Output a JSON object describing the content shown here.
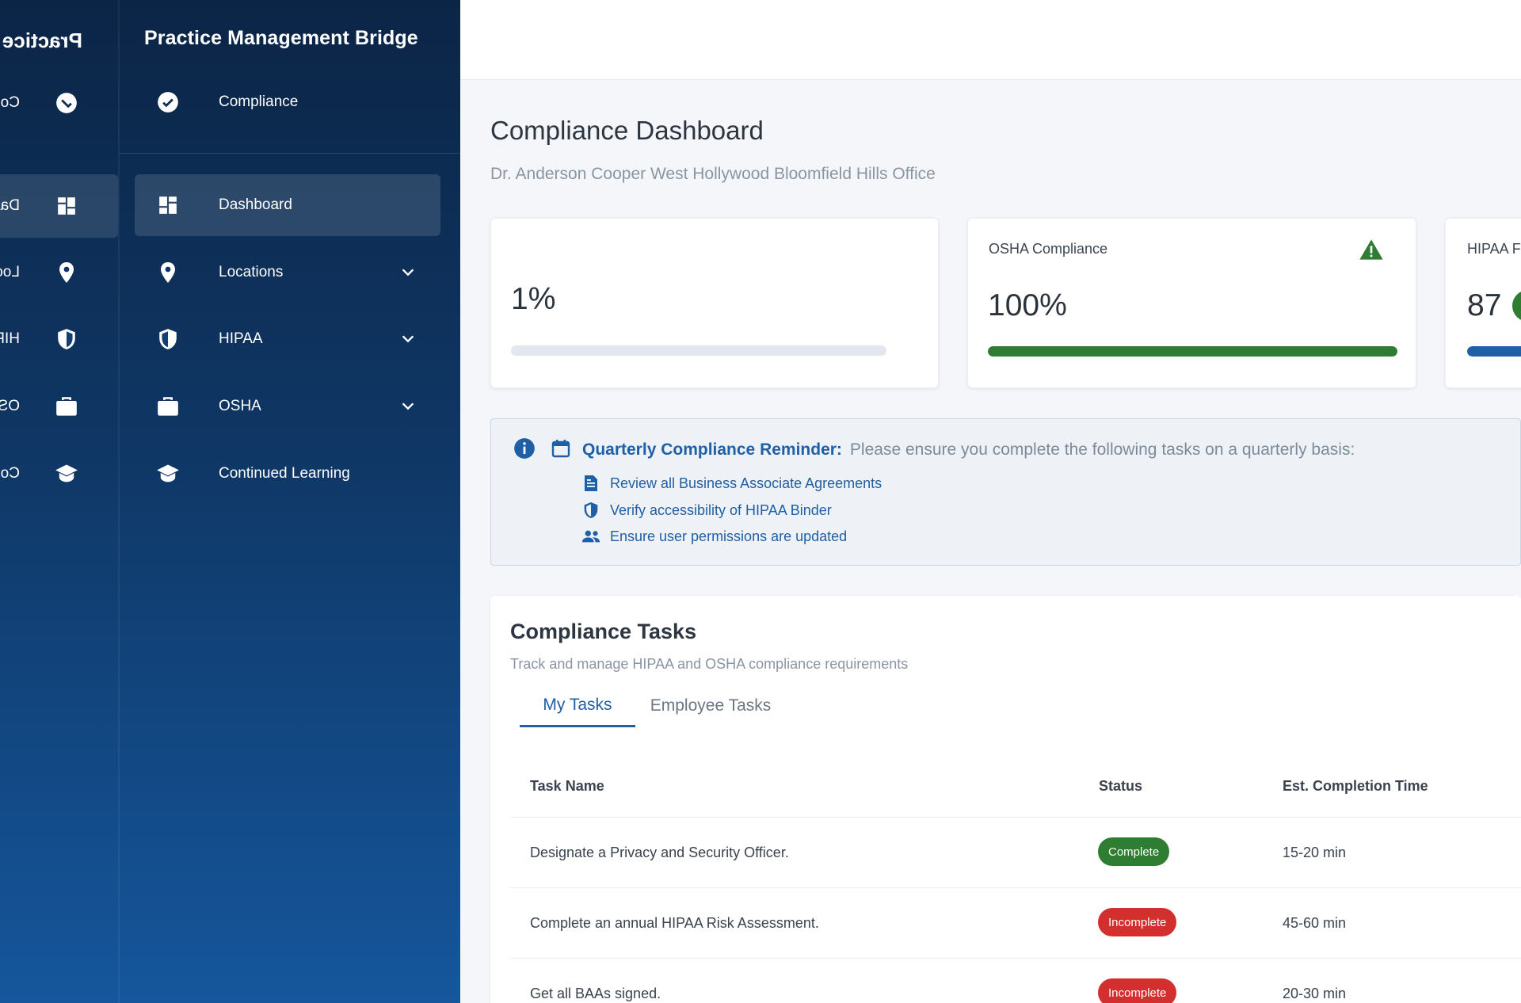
{
  "colors": {
    "accent": "#1f5fa6",
    "success": "#2e7d32",
    "danger": "#d32f2f",
    "sidebar_top": "#0b2546",
    "sidebar_bottom": "#15569c"
  },
  "sidebar": {
    "ghost_title": "Practice M",
    "ghost_labels": [
      "Com",
      "Dash",
      "Loca",
      "HIPA",
      "OSH",
      "Cont"
    ],
    "brand": "Practice Management Bridge",
    "items": [
      {
        "label": "Compliance",
        "icon": "check-circle-icon"
      },
      {
        "label": "Dashboard",
        "icon": "dashboard-grid-icon",
        "active": true
      },
      {
        "label": "Locations",
        "icon": "map-pin-icon",
        "expandable": true
      },
      {
        "label": "HIPAA",
        "icon": "shield-icon",
        "expandable": true
      },
      {
        "label": "OSHA",
        "icon": "briefcase-icon",
        "expandable": true
      },
      {
        "label": "Continued Learning",
        "icon": "graduation-cap-icon"
      }
    ]
  },
  "main": {
    "title": "Compliance Dashboard",
    "subtitle": "Dr. Anderson Cooper West Hollywood Bloomfield Hills Office",
    "stats": [
      {
        "label": "",
        "value": "1%",
        "progress": 0.01,
        "color": "#e3e8ee"
      },
      {
        "label": "OSHA Compliance",
        "value": "100%",
        "progress": 1.0,
        "color": "#2e7d32",
        "icon": "warning-triangle-icon"
      },
      {
        "label": "HIPAA F",
        "value": "87",
        "progress": 0.87,
        "color": "#1f5fa6"
      }
    ],
    "reminder": {
      "heading": "Quarterly Compliance Reminder:",
      "text": "Please ensure you complete the following tasks on a quarterly basis:",
      "items": [
        {
          "label": "Review all Business Associate Agreements",
          "icon": "document-icon"
        },
        {
          "label": "Verify accessibility of HIPAA Binder",
          "icon": "shield-icon"
        },
        {
          "label": "Ensure user permissions are updated",
          "icon": "users-icon"
        }
      ]
    },
    "tasks": {
      "title": "Compliance Tasks",
      "subtitle": "Track and manage HIPAA and OSHA compliance requirements",
      "tabs": [
        {
          "label": "My Tasks",
          "active": true
        },
        {
          "label": "Employee Tasks",
          "active": false
        }
      ],
      "columns": [
        "Task Name",
        "Status",
        "Est. Completion Time"
      ],
      "rows": [
        {
          "name": "Designate a Privacy and Security Officer.",
          "status": "Complete",
          "time": "15-20 min"
        },
        {
          "name": "Complete an annual HIPAA Risk Assessment.",
          "status": "Incomplete",
          "time": "45-60 min"
        },
        {
          "name": "Get all BAAs signed.",
          "status": "Incomplete",
          "time": "20-30 min"
        }
      ]
    }
  }
}
